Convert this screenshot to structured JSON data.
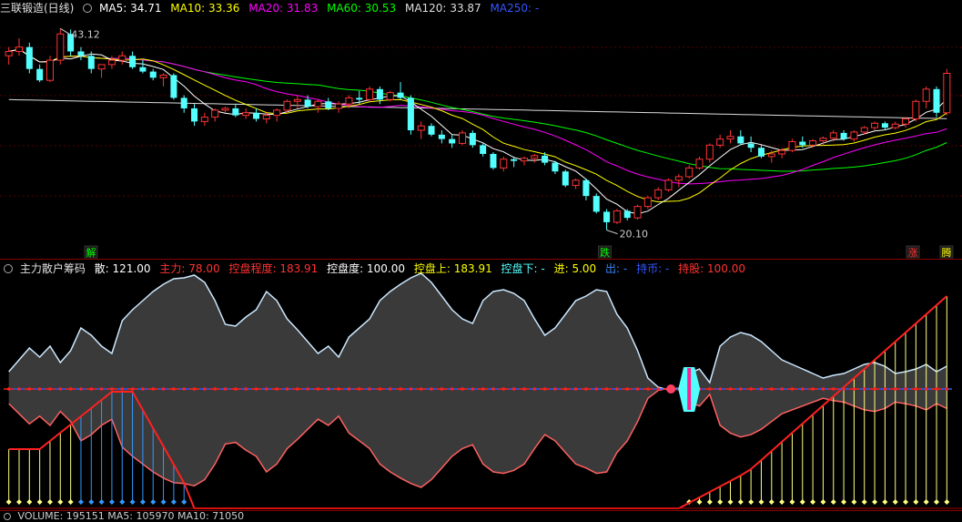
{
  "price_header": {
    "title": "三联锻造(日线)",
    "ma5_label": "MA5:",
    "ma5_value": "34.71",
    "ma5_color": "#ffffff",
    "ma10_label": "MA10:",
    "ma10_value": "33.36",
    "ma10_color": "#ffff00",
    "ma20_label": "MA20:",
    "ma20_value": "31.83",
    "ma20_color": "#ff00ff",
    "ma60_label": "MA60:",
    "ma60_value": "30.53",
    "ma60_color": "#00ff00",
    "ma120_label": "MA120:",
    "ma120_value": "33.87",
    "ma120_color": "#dddddd",
    "ma250_label": "MA250:",
    "ma250_value": "-",
    "ma250_color": "#3355ff"
  },
  "price_chart": {
    "high_label": "43.12",
    "low_label": "20.10",
    "markers": [
      {
        "text": "解",
        "color": "#00ff00"
      },
      {
        "text": "跌",
        "color": "#00ff00"
      },
      {
        "text": "涨",
        "color": "#ff3333"
      },
      {
        "text": "腾",
        "color": "#ffff00"
      }
    ],
    "up_color": "#ff3333",
    "down_color": "#54ffff",
    "candles": [
      [
        40,
        41,
        39,
        40.5
      ],
      [
        40.5,
        42,
        40,
        41
      ],
      [
        41,
        41.5,
        38,
        38.5
      ],
      [
        38.5,
        39,
        37,
        37.2
      ],
      [
        37.2,
        40,
        37,
        39.5
      ],
      [
        39.5,
        43.12,
        39,
        42.5
      ],
      [
        42.5,
        43,
        40,
        40.5
      ],
      [
        40.5,
        41,
        39.5,
        40
      ],
      [
        40,
        40.5,
        38,
        38.5
      ],
      [
        38.5,
        39,
        37.5,
        39
      ],
      [
        39,
        40,
        38.5,
        39.5
      ],
      [
        39.5,
        40.5,
        39,
        40
      ],
      [
        40,
        40.5,
        38.5,
        38.7
      ],
      [
        38.7,
        39.5,
        38,
        38.2
      ],
      [
        38.2,
        38.5,
        37.2,
        37.5
      ],
      [
        37.5,
        38,
        36.5,
        37.8
      ],
      [
        37.8,
        38,
        35,
        35.2
      ],
      [
        35.2,
        35.5,
        33.5,
        34
      ],
      [
        34,
        34.5,
        32,
        32.5
      ],
      [
        32.5,
        33.5,
        32,
        33
      ],
      [
        33,
        34,
        32.5,
        33.8
      ],
      [
        33.8,
        34.2,
        33.5,
        34
      ],
      [
        34,
        34.5,
        33,
        33.2
      ],
      [
        33.2,
        34,
        32.8,
        33.5
      ],
      [
        33.5,
        34,
        32.5,
        32.8
      ],
      [
        32.8,
        33.5,
        32.3,
        33.2
      ],
      [
        33.2,
        34,
        32.5,
        33.8
      ],
      [
        33.8,
        35,
        33.5,
        34.8
      ],
      [
        34.8,
        35.5,
        34,
        35
      ],
      [
        35,
        35.5,
        34,
        34.2
      ],
      [
        34.2,
        35,
        33.5,
        34.8
      ],
      [
        34.8,
        35.2,
        33.8,
        34
      ],
      [
        34,
        34.8,
        33.5,
        34.5
      ],
      [
        34.5,
        35.5,
        34,
        35.2
      ],
      [
        35.2,
        36,
        34.5,
        35
      ],
      [
        35,
        36.5,
        34.8,
        36.2
      ],
      [
        36.2,
        36.5,
        34.5,
        35
      ],
      [
        35,
        36,
        34.8,
        35.8
      ],
      [
        35.8,
        37,
        35,
        35.2
      ],
      [
        35.2,
        35.5,
        31,
        31.5
      ],
      [
        31.5,
        32.5,
        30.5,
        32
      ],
      [
        32,
        32.3,
        30.8,
        31
      ],
      [
        31,
        31.5,
        30,
        30.5
      ],
      [
        30.5,
        31,
        29.5,
        30
      ],
      [
        30,
        31.5,
        29.8,
        31.2
      ],
      [
        31.2,
        31.5,
        29.5,
        29.8
      ],
      [
        29.8,
        30,
        28.5,
        28.8
      ],
      [
        28.8,
        29,
        27,
        27.2
      ],
      [
        27.2,
        28.5,
        26.8,
        28.2
      ],
      [
        28.2,
        28.5,
        27.3,
        28
      ],
      [
        28,
        28.5,
        27.5,
        28.3
      ],
      [
        28.3,
        28.8,
        27.8,
        28.6
      ],
      [
        28.6,
        29,
        27.5,
        27.8
      ],
      [
        27.8,
        28,
        26.5,
        26.8
      ],
      [
        26.8,
        27,
        25,
        25.2
      ],
      [
        25.2,
        26,
        24.8,
        25.8
      ],
      [
        25.8,
        26,
        23.5,
        24
      ],
      [
        24,
        24.3,
        22,
        22.2
      ],
      [
        22.2,
        22.5,
        20.1,
        21
      ],
      [
        21,
        22.5,
        20.8,
        22.3
      ],
      [
        22.3,
        22.5,
        21.2,
        21.5
      ],
      [
        21.5,
        23,
        21.3,
        22.8
      ],
      [
        22.8,
        24,
        22.5,
        23.8
      ],
      [
        23.8,
        25,
        23.5,
        24.7
      ],
      [
        24.7,
        26,
        24.5,
        25.8
      ],
      [
        25.8,
        26.5,
        25,
        26.2
      ],
      [
        26.2,
        27.5,
        26,
        27.2
      ],
      [
        27.2,
        28.5,
        27,
        28.2
      ],
      [
        28.2,
        30,
        27.8,
        29.8
      ],
      [
        29.8,
        31,
        29.5,
        30.5
      ],
      [
        30.5,
        31.5,
        30,
        30.8
      ],
      [
        30.8,
        31.5,
        29.8,
        30
      ],
      [
        30,
        30.8,
        29,
        29.5
      ],
      [
        29.5,
        29.8,
        28.3,
        28.5
      ],
      [
        28.5,
        29.2,
        27.8,
        28.8
      ],
      [
        28.8,
        29.5,
        28.3,
        29.2
      ],
      [
        29.2,
        30.5,
        29,
        30.2
      ],
      [
        30.2,
        30.8,
        29.5,
        29.8
      ],
      [
        29.8,
        30.5,
        29.5,
        30.3
      ],
      [
        30.3,
        30.8,
        29.8,
        30.6
      ],
      [
        30.6,
        31.5,
        30.2,
        31.2
      ],
      [
        31.2,
        31.5,
        30.3,
        30.5
      ],
      [
        30.5,
        31.5,
        30.2,
        31.3
      ],
      [
        31.3,
        32,
        31,
        31.8
      ],
      [
        31.8,
        32.5,
        31.5,
        32.3
      ],
      [
        32.3,
        32.5,
        31.5,
        31.8
      ],
      [
        31.8,
        32.5,
        31.6,
        32.2
      ],
      [
        32.2,
        33,
        31.8,
        32.8
      ],
      [
        32.8,
        35,
        32.5,
        34.8
      ],
      [
        34.8,
        36.5,
        34,
        36.2
      ],
      [
        36.2,
        36.5,
        33,
        33.5
      ],
      [
        33.5,
        38.5,
        33.2,
        38
      ]
    ]
  },
  "indicator_header": {
    "title": "主力散户筹码",
    "san_label": "散:",
    "san_value": "121.00",
    "san_color": "#ffffff",
    "zhuli_label": "主力:",
    "zhuli_value": "78.00",
    "zhuli_color": "#ff3333",
    "kpcd_label": "控盘程度:",
    "kpcd_value": "183.91",
    "kpcd_color": "#ff3333",
    "kpd_label": "控盘度:",
    "kpd_value": "100.00",
    "kpd_color": "#ffffff",
    "kps_label": "控盘上:",
    "kps_value": "183.91",
    "kps_color": "#ffff00",
    "kpx_label": "控盘下:",
    "kpx_value": "-",
    "kpx_color": "#54ffff",
    "jin_label": "进:",
    "jin_value": "5.00",
    "jin_color": "#ffff00",
    "chu_label": "出:",
    "chu_value": "-",
    "chu_color": "#3388ff",
    "chibi_label": "持币:",
    "chibi_value": "-",
    "chibi_color": "#3355ff",
    "chigu_label": "持股:",
    "chigu_value": "100.00",
    "chigu_color": "#ff3333"
  },
  "volume_header": {
    "text": "VOLUME: 195151 MA5: 105970 MA10: 71050"
  }
}
